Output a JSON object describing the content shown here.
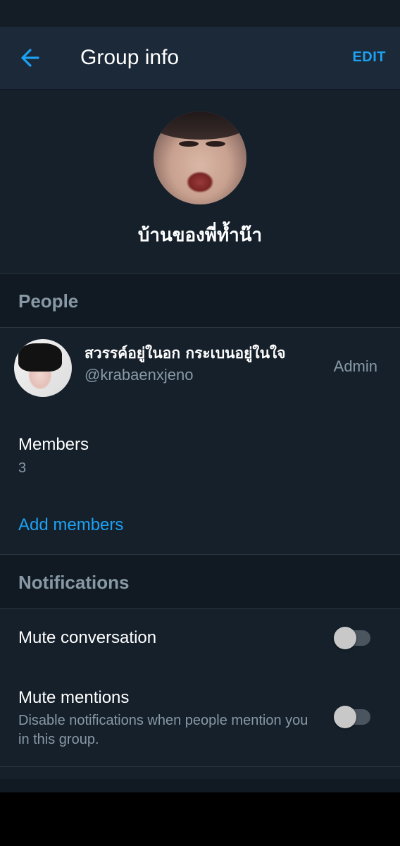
{
  "header": {
    "title": "Group info",
    "edit_label": "EDIT"
  },
  "group": {
    "name": "บ้านของพี่ท้ำน๊า"
  },
  "people": {
    "section_title": "People",
    "user": {
      "name": "สวรรค์อยู่ในอก กระเบนอยู่ในใจ",
      "handle": "@krabaenxjeno",
      "role": "Admin"
    },
    "members_label": "Members",
    "members_count": "3",
    "add_members_label": "Add members"
  },
  "notifications": {
    "section_title": "Notifications",
    "mute_conversation": {
      "label": "Mute conversation",
      "enabled": false
    },
    "mute_mentions": {
      "label": "Mute mentions",
      "description": "Disable notifications when people mention you in this group.",
      "enabled": false
    }
  },
  "colors": {
    "accent": "#1da1f2",
    "background": "#15202b",
    "header": "#1c2938",
    "secondary_text": "#8899a6"
  },
  "icons": {
    "back": "arrow-left-icon"
  }
}
